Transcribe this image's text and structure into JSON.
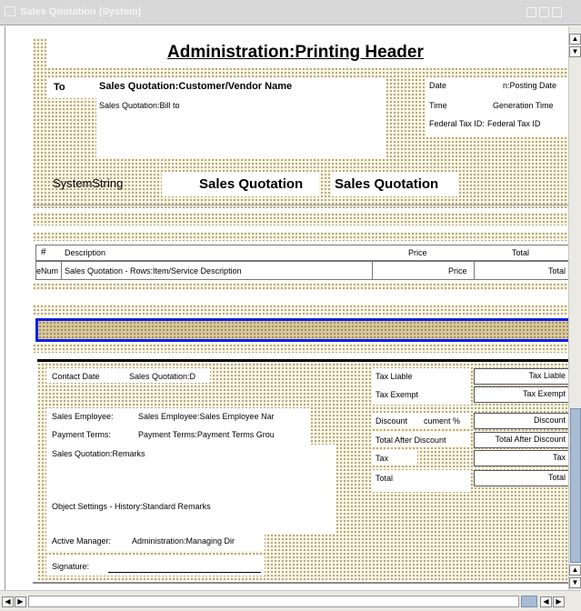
{
  "window": {
    "title": "Sales Quotation (System)"
  },
  "header": {
    "title": "Administration:Printing Header",
    "to_label": "To",
    "customer_name": "Sales Quotation:Customer/Vendor Name",
    "bill_to": "Sales Quotation:Bill to",
    "date_label": "Date",
    "date_value": "n:Posting Date",
    "time_label": "Time",
    "time_value": "Generation Time",
    "taxid_label": "Federal Tax ID:",
    "taxid_value": "Federal Tax ID",
    "system_string": "SystemString",
    "doc_title_1": "Sales Quotation",
    "doc_title_2": "Sales Quotation"
  },
  "table": {
    "headers": {
      "num": "#",
      "description": "Description",
      "price": "Price",
      "total": "Total"
    },
    "row": {
      "num": "eNum",
      "description": "Sales Quotation - Rows:Item/Service Description",
      "price": "Price",
      "total": "Total"
    }
  },
  "footer": {
    "contact_date_label": "Contact Date",
    "contact_date_value": "Sales Quotation:D",
    "sales_employee_label": "Sales Employee:",
    "sales_employee_value": "Sales Employee:Sales Employee Nar",
    "payment_terms_label": "Payment Terms:",
    "payment_terms_value": "Payment Terms:Payment Terms Grou",
    "remarks": "Sales Quotation:Remarks",
    "standard_remarks": "Object Settings - History:Standard Remarks",
    "active_manager_label": "Active Manager:",
    "active_manager_value": "Administration:Managing Dir",
    "signature_label": "Signature:"
  },
  "totals": {
    "tax_liable_label": "Tax Liable",
    "tax_liable_value": "Tax Liable",
    "tax_exempt_label": "Tax Exempt",
    "tax_exempt_value": "Tax Exempt",
    "discount_label": "Discount",
    "discount_mid": "cument %",
    "discount_value": "Discount",
    "after_discount_label": "Total After Discount",
    "after_discount_value": "Total After Discount",
    "tax_label": "Tax",
    "tax_value": "Tax",
    "total_label": "Total",
    "total_value": "Total"
  },
  "colors": {
    "selection_border": "#1020e0",
    "band": "#d8c89a",
    "dots_bg": "#fdf6dd"
  },
  "icons": [
    "window-icon",
    "minimize-icon",
    "maximize-icon",
    "close-icon",
    "scroll-up-arrow-icon",
    "scroll-down-arrow-icon",
    "scroll-left-arrow-icon",
    "scroll-right-arrow-icon"
  ]
}
